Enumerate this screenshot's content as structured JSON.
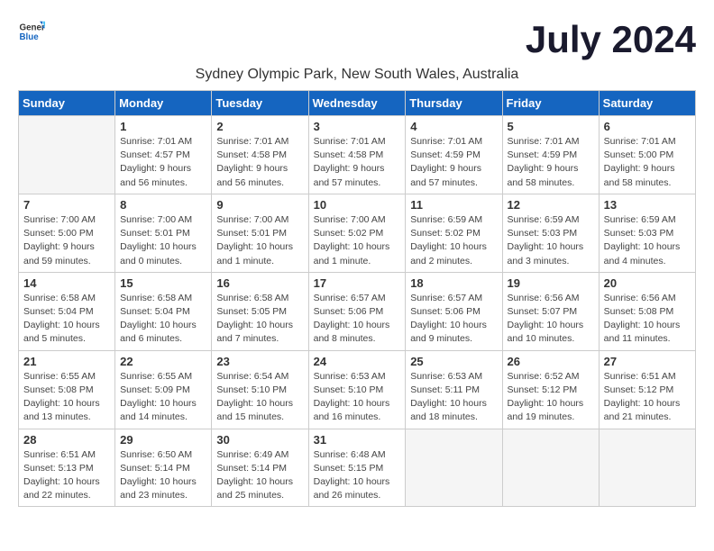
{
  "logo": {
    "general": "General",
    "blue": "Blue"
  },
  "title": "July 2024",
  "location": "Sydney Olympic Park, New South Wales, Australia",
  "headers": [
    "Sunday",
    "Monday",
    "Tuesday",
    "Wednesday",
    "Thursday",
    "Friday",
    "Saturday"
  ],
  "weeks": [
    [
      {
        "day": "",
        "sunrise": "",
        "sunset": "",
        "daylight": "",
        "empty": true
      },
      {
        "day": "1",
        "sunrise": "Sunrise: 7:01 AM",
        "sunset": "Sunset: 4:57 PM",
        "daylight": "Daylight: 9 hours and 56 minutes."
      },
      {
        "day": "2",
        "sunrise": "Sunrise: 7:01 AM",
        "sunset": "Sunset: 4:58 PM",
        "daylight": "Daylight: 9 hours and 56 minutes."
      },
      {
        "day": "3",
        "sunrise": "Sunrise: 7:01 AM",
        "sunset": "Sunset: 4:58 PM",
        "daylight": "Daylight: 9 hours and 57 minutes."
      },
      {
        "day": "4",
        "sunrise": "Sunrise: 7:01 AM",
        "sunset": "Sunset: 4:59 PM",
        "daylight": "Daylight: 9 hours and 57 minutes."
      },
      {
        "day": "5",
        "sunrise": "Sunrise: 7:01 AM",
        "sunset": "Sunset: 4:59 PM",
        "daylight": "Daylight: 9 hours and 58 minutes."
      },
      {
        "day": "6",
        "sunrise": "Sunrise: 7:01 AM",
        "sunset": "Sunset: 5:00 PM",
        "daylight": "Daylight: 9 hours and 58 minutes."
      }
    ],
    [
      {
        "day": "7",
        "sunrise": "Sunrise: 7:00 AM",
        "sunset": "Sunset: 5:00 PM",
        "daylight": "Daylight: 9 hours and 59 minutes."
      },
      {
        "day": "8",
        "sunrise": "Sunrise: 7:00 AM",
        "sunset": "Sunset: 5:01 PM",
        "daylight": "Daylight: 10 hours and 0 minutes."
      },
      {
        "day": "9",
        "sunrise": "Sunrise: 7:00 AM",
        "sunset": "Sunset: 5:01 PM",
        "daylight": "Daylight: 10 hours and 1 minute."
      },
      {
        "day": "10",
        "sunrise": "Sunrise: 7:00 AM",
        "sunset": "Sunset: 5:02 PM",
        "daylight": "Daylight: 10 hours and 1 minute."
      },
      {
        "day": "11",
        "sunrise": "Sunrise: 6:59 AM",
        "sunset": "Sunset: 5:02 PM",
        "daylight": "Daylight: 10 hours and 2 minutes."
      },
      {
        "day": "12",
        "sunrise": "Sunrise: 6:59 AM",
        "sunset": "Sunset: 5:03 PM",
        "daylight": "Daylight: 10 hours and 3 minutes."
      },
      {
        "day": "13",
        "sunrise": "Sunrise: 6:59 AM",
        "sunset": "Sunset: 5:03 PM",
        "daylight": "Daylight: 10 hours and 4 minutes."
      }
    ],
    [
      {
        "day": "14",
        "sunrise": "Sunrise: 6:58 AM",
        "sunset": "Sunset: 5:04 PM",
        "daylight": "Daylight: 10 hours and 5 minutes."
      },
      {
        "day": "15",
        "sunrise": "Sunrise: 6:58 AM",
        "sunset": "Sunset: 5:04 PM",
        "daylight": "Daylight: 10 hours and 6 minutes."
      },
      {
        "day": "16",
        "sunrise": "Sunrise: 6:58 AM",
        "sunset": "Sunset: 5:05 PM",
        "daylight": "Daylight: 10 hours and 7 minutes."
      },
      {
        "day": "17",
        "sunrise": "Sunrise: 6:57 AM",
        "sunset": "Sunset: 5:06 PM",
        "daylight": "Daylight: 10 hours and 8 minutes."
      },
      {
        "day": "18",
        "sunrise": "Sunrise: 6:57 AM",
        "sunset": "Sunset: 5:06 PM",
        "daylight": "Daylight: 10 hours and 9 minutes."
      },
      {
        "day": "19",
        "sunrise": "Sunrise: 6:56 AM",
        "sunset": "Sunset: 5:07 PM",
        "daylight": "Daylight: 10 hours and 10 minutes."
      },
      {
        "day": "20",
        "sunrise": "Sunrise: 6:56 AM",
        "sunset": "Sunset: 5:08 PM",
        "daylight": "Daylight: 10 hours and 11 minutes."
      }
    ],
    [
      {
        "day": "21",
        "sunrise": "Sunrise: 6:55 AM",
        "sunset": "Sunset: 5:08 PM",
        "daylight": "Daylight: 10 hours and 13 minutes."
      },
      {
        "day": "22",
        "sunrise": "Sunrise: 6:55 AM",
        "sunset": "Sunset: 5:09 PM",
        "daylight": "Daylight: 10 hours and 14 minutes."
      },
      {
        "day": "23",
        "sunrise": "Sunrise: 6:54 AM",
        "sunset": "Sunset: 5:10 PM",
        "daylight": "Daylight: 10 hours and 15 minutes."
      },
      {
        "day": "24",
        "sunrise": "Sunrise: 6:53 AM",
        "sunset": "Sunset: 5:10 PM",
        "daylight": "Daylight: 10 hours and 16 minutes."
      },
      {
        "day": "25",
        "sunrise": "Sunrise: 6:53 AM",
        "sunset": "Sunset: 5:11 PM",
        "daylight": "Daylight: 10 hours and 18 minutes."
      },
      {
        "day": "26",
        "sunrise": "Sunrise: 6:52 AM",
        "sunset": "Sunset: 5:12 PM",
        "daylight": "Daylight: 10 hours and 19 minutes."
      },
      {
        "day": "27",
        "sunrise": "Sunrise: 6:51 AM",
        "sunset": "Sunset: 5:12 PM",
        "daylight": "Daylight: 10 hours and 21 minutes."
      }
    ],
    [
      {
        "day": "28",
        "sunrise": "Sunrise: 6:51 AM",
        "sunset": "Sunset: 5:13 PM",
        "daylight": "Daylight: 10 hours and 22 minutes."
      },
      {
        "day": "29",
        "sunrise": "Sunrise: 6:50 AM",
        "sunset": "Sunset: 5:14 PM",
        "daylight": "Daylight: 10 hours and 23 minutes."
      },
      {
        "day": "30",
        "sunrise": "Sunrise: 6:49 AM",
        "sunset": "Sunset: 5:14 PM",
        "daylight": "Daylight: 10 hours and 25 minutes."
      },
      {
        "day": "31",
        "sunrise": "Sunrise: 6:48 AM",
        "sunset": "Sunset: 5:15 PM",
        "daylight": "Daylight: 10 hours and 26 minutes."
      },
      {
        "day": "",
        "sunrise": "",
        "sunset": "",
        "daylight": "",
        "empty": true
      },
      {
        "day": "",
        "sunrise": "",
        "sunset": "",
        "daylight": "",
        "empty": true
      },
      {
        "day": "",
        "sunrise": "",
        "sunset": "",
        "daylight": "",
        "empty": true
      }
    ]
  ]
}
